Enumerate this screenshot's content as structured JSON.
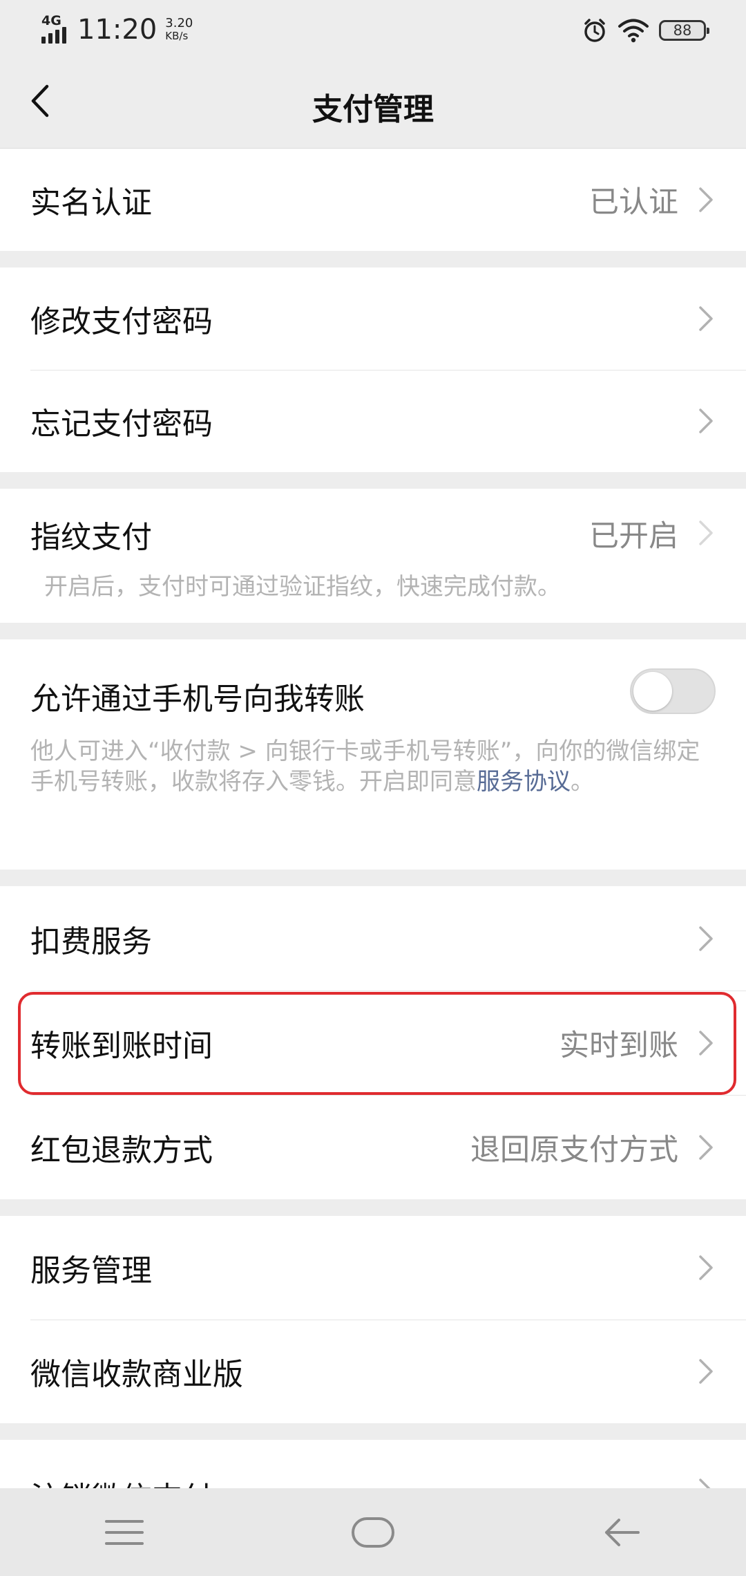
{
  "status_bar": {
    "network": "4G",
    "time": "11:20",
    "speed_value": "3.20",
    "speed_unit": "KB/s",
    "battery": "88",
    "icons": [
      "signal-icon",
      "alarm-icon",
      "wifi-icon",
      "battery-icon"
    ]
  },
  "header": {
    "title": "支付管理",
    "back_icon": "back-chevron-icon"
  },
  "groups": {
    "identity": {
      "label": "实名认证",
      "value": "已认证"
    },
    "password": {
      "change_label": "修改支付密码",
      "forgot_label": "忘记支付密码"
    },
    "fingerprint": {
      "label": "指纹支付",
      "value": "已开启",
      "description": "开启后，支付时可通过验证指纹，快速完成付款。"
    },
    "phone_transfer": {
      "label": "允许通过手机号向我转账",
      "toggle_on": false,
      "description": "他人可进入“收付款 > 向银行卡或手机号转账”，向你的微信绑定手机号转账，收款将存入零钱。开启即同意",
      "link_text": "服务协议",
      "description_end": "。"
    },
    "services": {
      "deduction_label": "扣费服务",
      "transfer_time_label": "转账到账时间",
      "transfer_time_value": "实时到账",
      "red_packet_label": "红包退款方式",
      "red_packet_value": "退回原支付方式"
    },
    "manage": {
      "service_manage_label": "服务管理",
      "merchant_label": "微信收款商业版"
    },
    "partial": {
      "label": "注销微信支付"
    }
  },
  "bottom_nav": {
    "icons": [
      "menu-icon",
      "home-icon",
      "back-icon"
    ]
  },
  "colors": {
    "background": "#ededed",
    "card": "#ffffff",
    "text": "#111111",
    "secondary": "#888888",
    "hint": "#b3b3b3",
    "link": "#576b95",
    "highlight": "#e02b2f"
  }
}
